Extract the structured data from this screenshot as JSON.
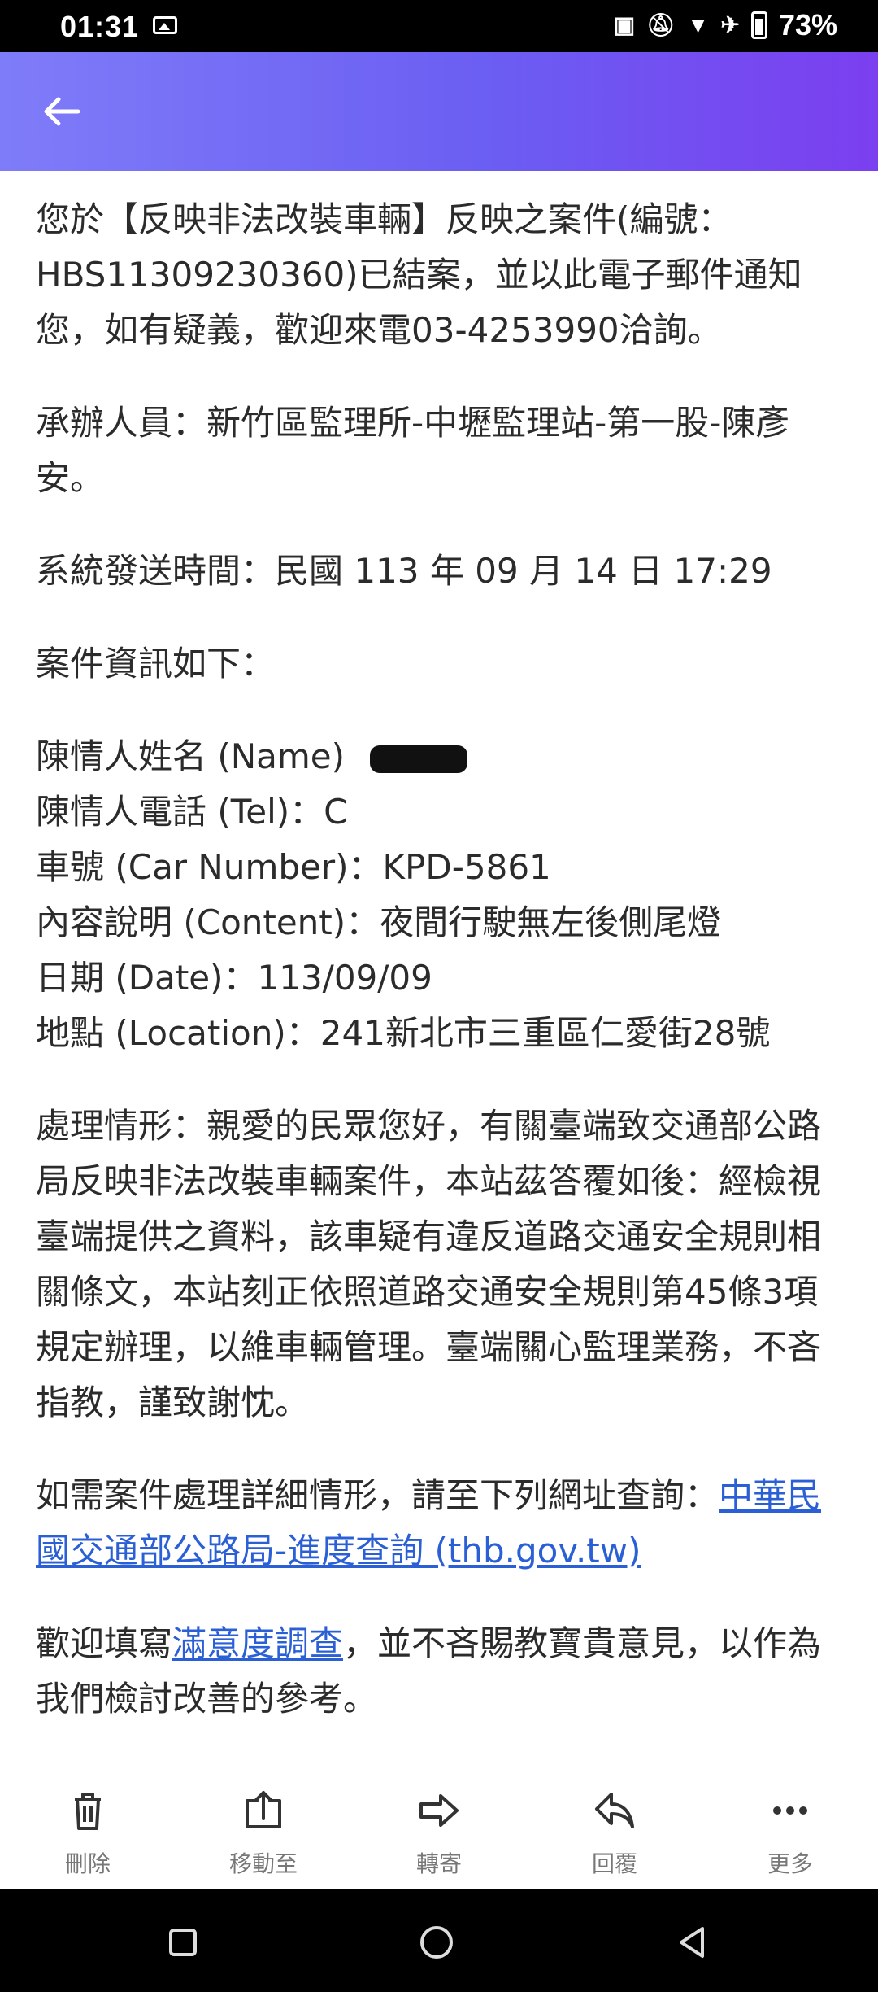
{
  "status": {
    "time": "01:31",
    "battery": "73%"
  },
  "email": {
    "para1": "您於【反映非法改裝車輛】反映之案件(編號：HBS11309230360)已結案，並以此電子郵件通知您，如有疑義，歡迎來電03-4253990洽詢。",
    "para2": "承辦人員：新竹區監理所-中壢監理站-第一股-陳彥安。",
    "para3": "系統發送時間：民國 113 年 09 月 14 日 17:29",
    "para4": "案件資訊如下：",
    "info": {
      "name_label": "陳情人姓名 (Name)",
      "tel_label": "陳情人電話 (Tel)：C",
      "car": "車號 (Car Number)：KPD-5861",
      "content": "內容說明 (Content)：夜間行駛無左後側尾燈",
      "date": "日期 (Date)：113/09/09",
      "location": "地點 (Location)：241新北市三重區仁愛街28號"
    },
    "para5": "處理情形：親愛的民眾您好，有關臺端致交通部公路局反映非法改裝車輛案件，本站茲答覆如後：經檢視臺端提供之資料，該車疑有違反道路交通安全規則相關條文，本站刻正依照道路交通安全規則第45條3項規定辦理，以維車輛管理。臺端關心監理業務，不吝指教，謹致謝忱。",
    "para6_text": "如需案件處理詳細情形，請至下列網址查詢：",
    "para6_link": "中華民國交通部公路局-進度查詢 (thb.gov.tw)",
    "para7_pre": "歡迎填寫",
    "para7_link": "滿意度調查",
    "para7_post": "，並不吝賜教寶貴意見，以作為我們檢討改善的參考。"
  },
  "actions": [
    {
      "label": "刪除",
      "icon": "trash-icon"
    },
    {
      "label": "移動至",
      "icon": "move-to-icon"
    },
    {
      "label": "轉寄",
      "icon": "forward-icon"
    },
    {
      "label": "回覆",
      "icon": "reply-icon"
    },
    {
      "label": "更多",
      "icon": "more-icon"
    }
  ],
  "colors": {
    "appbar_start": "#7f7cf9",
    "appbar_end": "#7b3ff0",
    "link": "#2a5fd6"
  }
}
